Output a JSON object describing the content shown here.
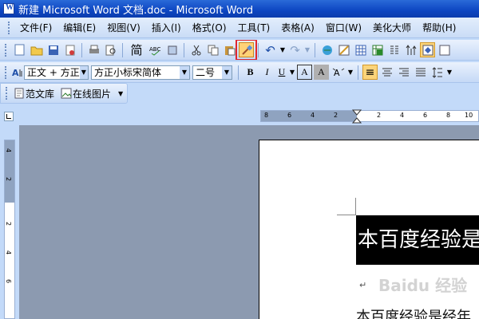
{
  "window": {
    "title": "新建 Microsoft Word 文档.doc - Microsoft Word"
  },
  "menu": [
    "文件(F)",
    "编辑(E)",
    "视图(V)",
    "插入(I)",
    "格式(O)",
    "工具(T)",
    "表格(A)",
    "窗口(W)",
    "美化大师",
    "帮助(H)"
  ],
  "standard_toolbar": {
    "simplified_label": "简",
    "highlighted_tool": "format-painter"
  },
  "formatting_toolbar": {
    "style_value": "正文 + 方正",
    "font_value": "方正小标宋简体",
    "size_value": "二号",
    "bold": "B",
    "italic": "I",
    "underline": "U",
    "char_border": "A",
    "char_shading": "A",
    "align_left": "≡"
  },
  "extra_toolbar": {
    "template_library": "范文库",
    "online_pictures": "在线图片"
  },
  "ruler": {
    "ticks": [
      "8",
      "6",
      "4",
      "2",
      "2",
      "4",
      "6",
      "8",
      "10"
    ],
    "vticks": [
      "4",
      "2",
      "2",
      "4",
      "6"
    ]
  },
  "document": {
    "heading": "本百度经验是经验",
    "paragraph_mark": "↵",
    "body": "本百度经验是经年"
  },
  "watermark": "Baidu 经验",
  "colors": {
    "title_bar": "#0d46c2",
    "highlight_box": "#e0272f",
    "workspace": "#8c9ab0"
  }
}
